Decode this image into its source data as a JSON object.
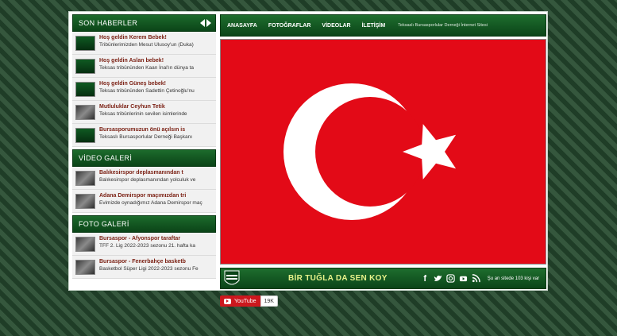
{
  "sidebar": {
    "news": {
      "title": "SON HABERLER",
      "items": [
        {
          "title": "Hoş geldin Kerem Bebek!",
          "sub": "Tribünlerimizden Mesut Ulusoy'un (Duka)",
          "thumb": "logo"
        },
        {
          "title": "Hoş geldin Aslan bebek!",
          "sub": "Teksas tribününden Kaan İnal'ın dünya ta",
          "thumb": "logo"
        },
        {
          "title": "Hoş geldin Güneş bebek!",
          "sub": "Teksas tribününden Sadettin Çetinoğlu'nu",
          "thumb": "logo"
        },
        {
          "title": "Mutluluklar Ceyhun Tetik",
          "sub": "Teksas tribünlerinin sevilen isimlerinde",
          "thumb": "photo"
        },
        {
          "title": "Bursasporumuzun önü açılsın is",
          "sub": "Teksaslı Bursasporlular Derneği Başkanı",
          "thumb": "logo"
        }
      ]
    },
    "videos": {
      "title": "VİDEO GALERİ",
      "items": [
        {
          "title": "Balıkesirspor deplasmanından t",
          "sub": "Balıkesirspor deplasmanından yolculuk ve",
          "thumb": "photo"
        },
        {
          "title": "Adana Demirspor maçımızdan tri",
          "sub": "Evimizde oynadığımız Adana Demirspor maç",
          "thumb": "photo"
        }
      ]
    },
    "photos": {
      "title": "FOTO GALERİ",
      "items": [
        {
          "title": "Bursaspor - Afyonspor taraftar",
          "sub": "TFF 2. Lig 2022-2023 sezonu 21. hafta ka",
          "thumb": "photo"
        },
        {
          "title": "Bursaspor - Fenerbahçe basketb",
          "sub": "Basketbol Süper Ligi 2022-2023 sezonu Fe",
          "thumb": "photo"
        }
      ]
    }
  },
  "nav": {
    "links": [
      "ANASAYFA",
      "FOTOĞRAFLAR",
      "VİDEOLAR",
      "İLETİŞİM"
    ],
    "subtitle": "Teksaslı Bursasporlular Derneği İnternet Sitesi"
  },
  "flag": {
    "name": "turkish-flag",
    "red": "#e30a17",
    "white": "#ffffff"
  },
  "footer": {
    "slogan": "BİR TUĞLA DA SEN KOY",
    "socials": [
      "facebook-icon",
      "twitter-icon",
      "instagram-icon",
      "youtube-icon",
      "rss-icon"
    ],
    "online": "Şu an sitede 103 kişi var"
  },
  "youtube_widget": {
    "label": "YouTube",
    "count": "19K"
  },
  "colors": {
    "brand_green": "#0b4418",
    "accent_red": "#7a1f12",
    "slogan_yellow": "#e7f28a"
  }
}
